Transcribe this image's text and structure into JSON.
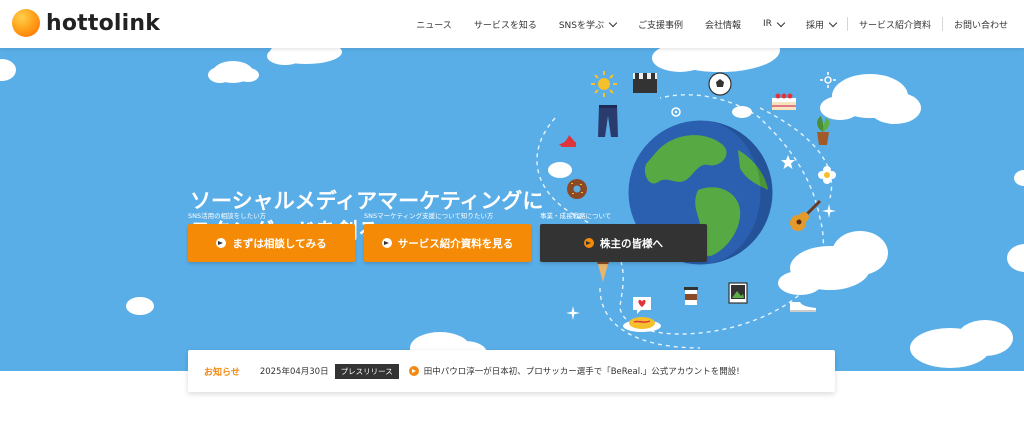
{
  "brand": {
    "name": "hottolink"
  },
  "nav": {
    "items": [
      {
        "label": "ニュース",
        "dropdown": false
      },
      {
        "label": "サービスを知る",
        "dropdown": false
      },
      {
        "label": "SNSを学ぶ",
        "dropdown": true
      },
      {
        "label": "ご支援事例",
        "dropdown": false
      },
      {
        "label": "会社情報",
        "dropdown": false
      },
      {
        "label": "IR",
        "dropdown": true
      },
      {
        "label": "採用",
        "dropdown": true
      },
      {
        "label": "サービス紹介資料",
        "dropdown": false
      },
      {
        "label": "お問い合わせ",
        "dropdown": false
      }
    ]
  },
  "hero": {
    "title_line1": "ソーシャルメディアマーケティングに",
    "title_line2": "スタンダードを創る",
    "ctas": [
      {
        "caption": "SNS活用の相談をしたい方",
        "label": "まずは相談してみる",
        "color": "#f58a07"
      },
      {
        "caption": "SNSマーケティング支援について知りたい方",
        "label": "サービス紹介資料を見る",
        "color": "#f58a07"
      },
      {
        "caption": "事業・成長戦略について",
        "label": "株主の皆様へ",
        "color": "#333333"
      }
    ],
    "illustration": [
      "globe-icon",
      "sun-icon",
      "clapperboard-icon",
      "soccer-ball-icon",
      "cake-icon",
      "jeans-icon",
      "high-heel-icon",
      "plant-icon",
      "star-icon",
      "flower-icon",
      "guitar-icon",
      "donut-icon",
      "icecream-icon",
      "coffee-icon",
      "photo-icon",
      "sneaker-icon",
      "heart-message-icon",
      "omelette-icon",
      "sparkle-icon"
    ]
  },
  "news": {
    "label": "お知らせ",
    "date": "2025年04月30日",
    "badge": "プレスリリース",
    "text": "田中パウロ淳一が日本初、プロサッカー選手で「BeReal.」公式アカウントを開設!"
  },
  "colors": {
    "accent": "#f58a07",
    "hero_bg": "#5aaee8",
    "dark": "#333333"
  }
}
